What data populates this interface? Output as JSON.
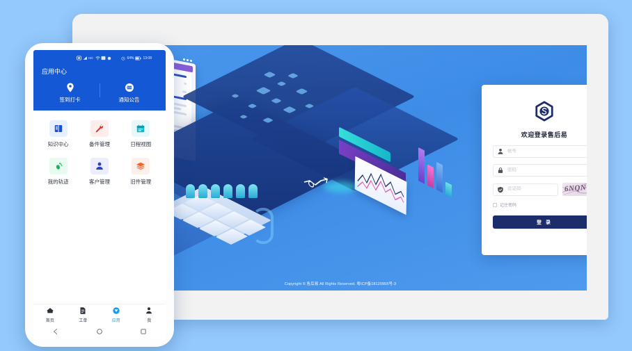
{
  "page": {
    "background_color": "#93c9fc"
  },
  "tablet": {
    "name": "tablet-device-mockup",
    "frame_color": "#f2f2f2"
  },
  "website": {
    "illustration_alt": "isometric cloud data platform illustration",
    "copyright": "Copyright © 售后易 All Rights Reserved.  粤ICP备18120955号-3",
    "login": {
      "logo_name": "shouhouyi-hexagon-s-logo",
      "title": "欢迎登录售后易",
      "fields": [
        {
          "name": "account",
          "icon": "user-icon",
          "placeholder": "帐号",
          "value": ""
        },
        {
          "name": "password",
          "icon": "lock-icon",
          "placeholder": "密码",
          "value": ""
        },
        {
          "name": "captcha",
          "icon": "shield-check-icon",
          "placeholder": "验证码",
          "value": ""
        }
      ],
      "captcha_text": "6NQN",
      "remember_label": "记住密码",
      "submit_label": "登 录",
      "accent_color": "#1b2d6b"
    }
  },
  "phone": {
    "statusbar": {
      "left_icons": [
        "sim-icon",
        "signal-icon",
        "hd-icon",
        "wifi-icon",
        "bluetooth-icon",
        "dot-icon"
      ],
      "right_icons": [
        "alarm-icon",
        "battery-icon"
      ],
      "battery_text": "64%",
      "time": "13:08"
    },
    "header_title": "应用中心",
    "accent_color": "#1558d6",
    "quick_actions": [
      {
        "label": "签到打卡",
        "icon": "location-pin-icon"
      },
      {
        "label": "通知公告",
        "icon": "megaphone-icon"
      }
    ],
    "apps": [
      {
        "label": "知识中心",
        "icon": "book-icon",
        "icon_color": "#1a53d0",
        "bg": "#e8f0ff"
      },
      {
        "label": "备件管理",
        "icon": "wrench-icon",
        "icon_color": "#d93025",
        "bg": "#fdeeec"
      },
      {
        "label": "日程视图",
        "icon": "calendar-icon",
        "icon_color": "#12b5c9",
        "bg": "#e7f8fa"
      },
      {
        "label": "我的轨迹",
        "icon": "footprints-icon",
        "icon_color": "#16b35a",
        "bg": "#e9faf0"
      },
      {
        "label": "客户管理",
        "icon": "person-icon",
        "icon_color": "#2b3fd0",
        "bg": "#eceefd"
      },
      {
        "label": "旧件管理",
        "icon": "layers-icon",
        "icon_color": "#f2622a",
        "bg": "#fdefe9"
      }
    ],
    "tabs": [
      {
        "label": "首页",
        "icon": "home-icon",
        "active": false
      },
      {
        "label": "工单",
        "icon": "document-icon",
        "active": false
      },
      {
        "label": "应用",
        "icon": "apps-badge-icon",
        "active": true
      },
      {
        "label": "我",
        "icon": "profile-icon",
        "active": false
      }
    ],
    "nav_buttons": [
      "back-triangle-icon",
      "home-circle-icon",
      "recents-square-icon"
    ]
  }
}
